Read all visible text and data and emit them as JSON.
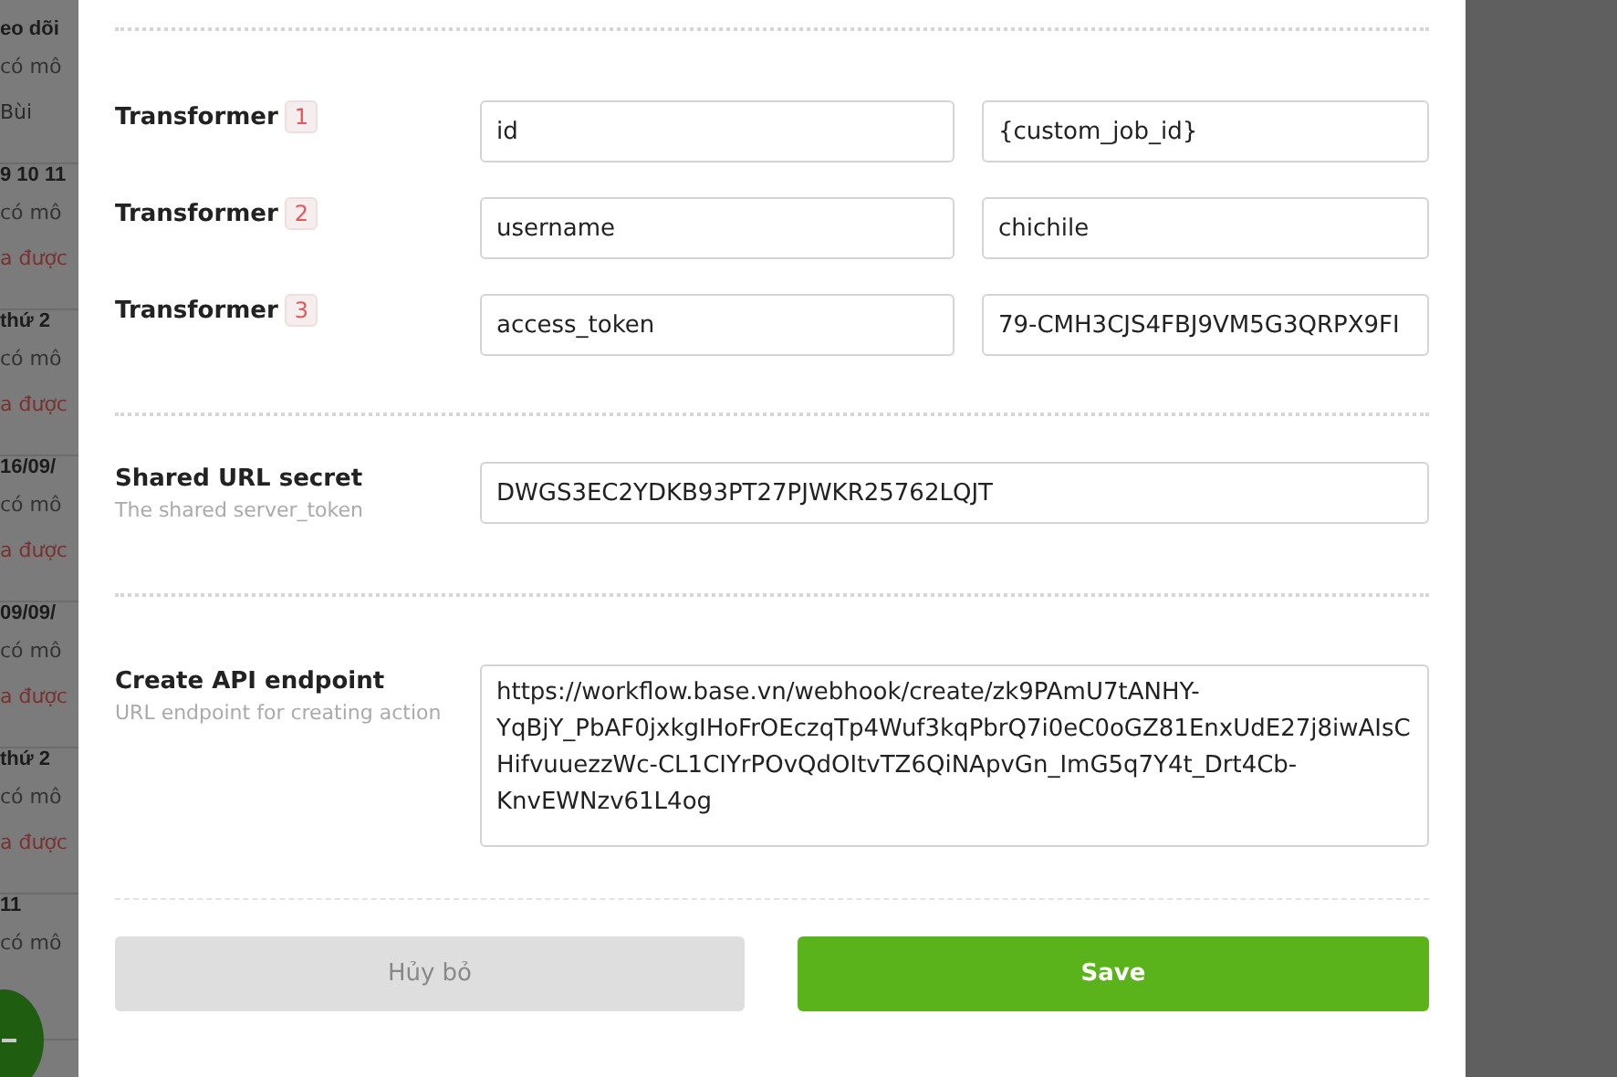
{
  "background_list": [
    {
      "title": "eo dõi",
      "description": "có mô",
      "extra": "Bùi"
    },
    {
      "title": "9 10 11",
      "description": "có mô",
      "extra": "a được"
    },
    {
      "title": "thứ 2",
      "description": "có mô",
      "extra": "a được"
    },
    {
      "title": "16/09/",
      "description": "có mô",
      "extra": "a được"
    },
    {
      "title": "09/09/",
      "description": "có mô",
      "extra": "a được"
    },
    {
      "title": "thứ 2",
      "description": "có mô",
      "extra": "a được"
    },
    {
      "title": "11",
      "description": "có mô"
    }
  ],
  "transformers": [
    {
      "label": "Transformer",
      "number": "1",
      "key": "id",
      "value": "{custom_job_id}"
    },
    {
      "label": "Transformer",
      "number": "2",
      "key": "username",
      "value": "chichile"
    },
    {
      "label": "Transformer",
      "number": "3",
      "key": "access_token",
      "value": "79-CMH3CJS4FBJ9VM5G3QRPX9FI"
    }
  ],
  "shared_secret": {
    "label": "Shared URL secret",
    "hint": "The shared server_token",
    "value": "DWGS3EC2YDKB93PT27PJWKR25762LQJT"
  },
  "create_endpoint": {
    "label": "Create API endpoint",
    "hint": "URL endpoint for creating action",
    "value": "https://workflow.base.vn/webhook/create/zk9PAmU7tANHY-YqBjY_PbAF0jxkgIHoFrOEczqTp4Wuf3kqPbrQ7i0eC0oGZ81EnxUdE27j8iwAIsCHifvuuezzWc-CL1CIYrPOvQdOItvTZ6QiNApvGn_ImG5q7Y4t_Drt4Cb-KnvEWNzv61L4og"
  },
  "buttons": [
    {
      "label": "Hủy bỏ",
      "kind": "cancel"
    },
    {
      "label": "Save",
      "kind": "primary"
    }
  ]
}
